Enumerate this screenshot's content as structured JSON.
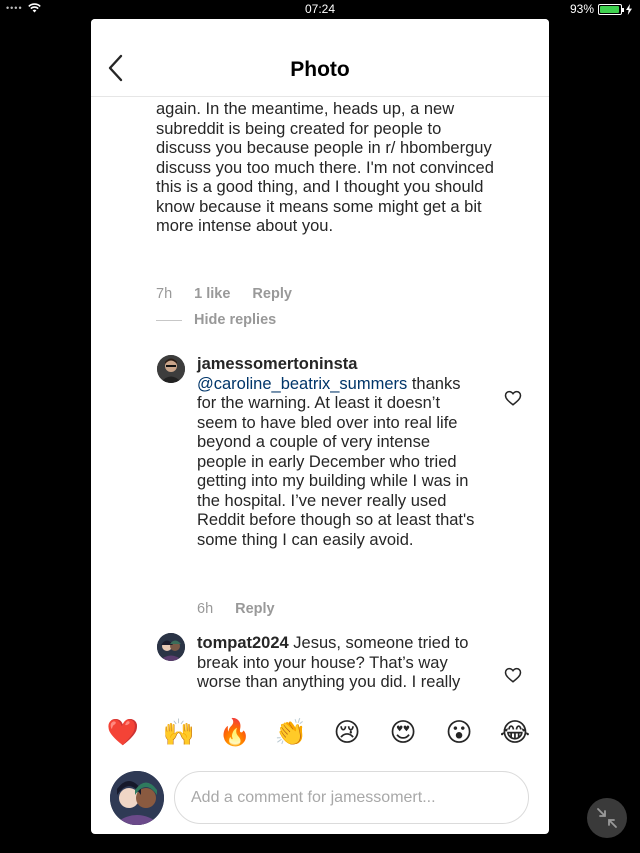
{
  "status_bar": {
    "carrier_dots": "••••",
    "time": "07:24",
    "battery_percent": "93%",
    "battery_level": 0.93,
    "icons": [
      "wifi-icon",
      "battery-icon",
      "charging-icon"
    ]
  },
  "header": {
    "title": "Photo",
    "back_icon": "chevron-left-icon"
  },
  "comments": {
    "partial": {
      "text": "again. In the meantime, heads up, a new subreddit is being created for people to discuss you because people in r/ hbomberguy discuss you too much there. I'm not convinced this is a good thing, and I thought you should know because it means some might get a bit more intense about you.",
      "time": "7h",
      "likes": "1 like",
      "reply_label": "Reply"
    },
    "hide_replies_label": "Hide replies",
    "reply1": {
      "username": "jamessomertoninsta",
      "mention": "@caroline_beatrix_summers",
      "text": " thanks for the warning. At least it doesn’t seem to have bled over into real life beyond a couple of very intense people in early December who tried getting into my building while I was in the hospital. I’ve never really used Reddit before though so at least that's some thing I can easily avoid.",
      "time": "6h",
      "reply_label": "Reply"
    },
    "reply2": {
      "username": "tompat2024",
      "text": " Jesus, someone tried to break into your house? That’s way worse than anything you did. I really really struggle to side with"
    }
  },
  "emoji_reactions": [
    "❤️",
    "🙌",
    "🔥",
    "👏",
    "😢",
    "😍",
    "😮",
    "😂"
  ],
  "composer": {
    "placeholder": "Add a comment for jamessomert..."
  },
  "colors": {
    "link": "#003569",
    "muted": "#999999",
    "heart": "#ed4956",
    "battery": "#3fd14f"
  }
}
